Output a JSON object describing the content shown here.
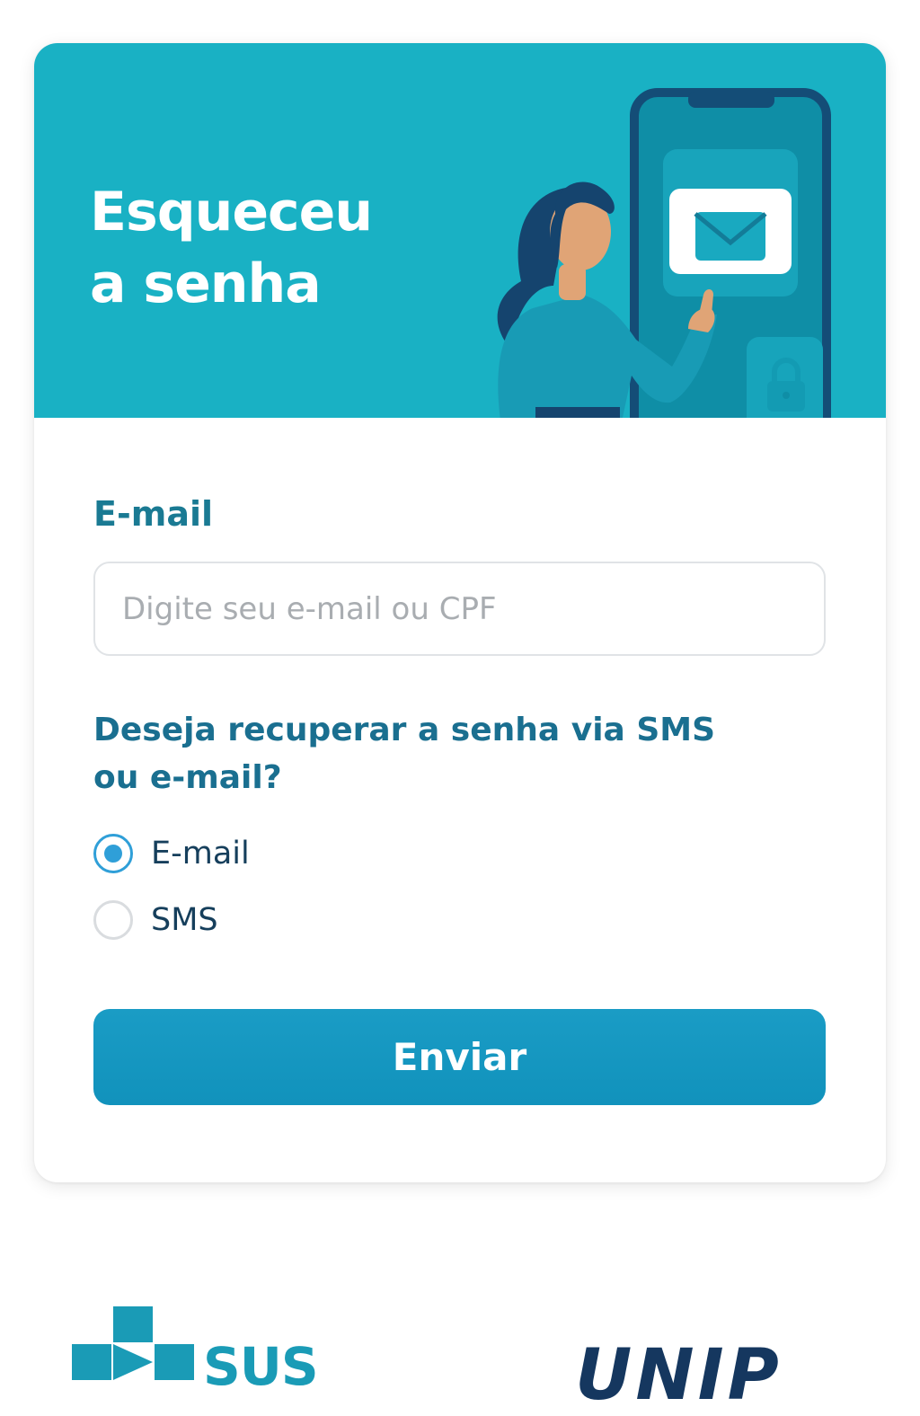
{
  "colors": {
    "hero_background": "#19b1c4",
    "primary": "#1a9cc5",
    "label_text": "#1a7a93",
    "radio_accent": "#2f9fd8",
    "unip_brand": "#15375f"
  },
  "hero": {
    "title_line1": "Esqueceu",
    "title_line2": "a senha",
    "illustration": "woman-tapping-phone-email-icon"
  },
  "form": {
    "email_label": "E-mail",
    "email_placeholder": "Digite seu e-mail ou CPF",
    "email_value": "",
    "question_line1": "Deseja recuperar a senha via SMS",
    "question_line2": "ou e-mail?",
    "options": [
      {
        "label": "E-mail",
        "selected": true
      },
      {
        "label": "SMS",
        "selected": false
      }
    ],
    "submit_label": "Enviar"
  },
  "footer": {
    "sus_text": "SUS",
    "unip_text": "UNIP"
  }
}
